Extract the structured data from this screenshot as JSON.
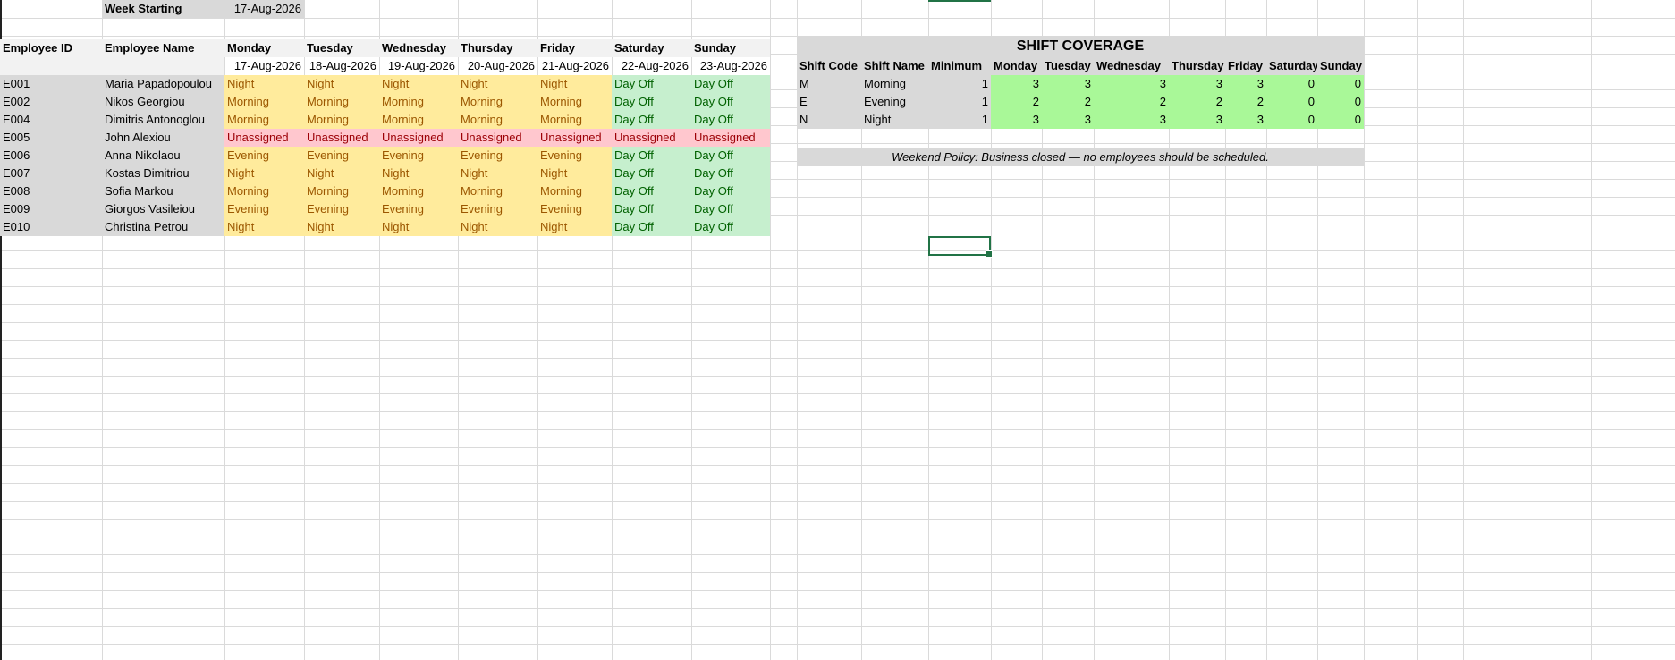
{
  "header": {
    "week_label": "Week Starting",
    "week_value": "17-Aug-2026"
  },
  "roster": {
    "columns": [
      "Employee ID",
      "Employee Name",
      "Monday",
      "Tuesday",
      "Wednesday",
      "Thursday",
      "Friday",
      "Saturday",
      "Sunday"
    ],
    "dates": [
      "17-Aug-2026",
      "18-Aug-2026",
      "19-Aug-2026",
      "20-Aug-2026",
      "21-Aug-2026",
      "22-Aug-2026",
      "23-Aug-2026"
    ],
    "rows": [
      {
        "id": "E001",
        "name": "Maria Papadopoulou",
        "days": [
          "Night",
          "Night",
          "Night",
          "Night",
          "Night",
          "Day Off",
          "Day Off"
        ]
      },
      {
        "id": "E002",
        "name": "Nikos Georgiou",
        "days": [
          "Morning",
          "Morning",
          "Morning",
          "Morning",
          "Morning",
          "Day Off",
          "Day Off"
        ]
      },
      {
        "id": "E004",
        "name": "Dimitris Antonoglou",
        "days": [
          "Morning",
          "Morning",
          "Morning",
          "Morning",
          "Morning",
          "Day Off",
          "Day Off"
        ]
      },
      {
        "id": "E005",
        "name": "John Alexiou",
        "days": [
          "Unassigned",
          "Unassigned",
          "Unassigned",
          "Unassigned",
          "Unassigned",
          "Unassigned",
          "Unassigned"
        ]
      },
      {
        "id": "E006",
        "name": "Anna Nikolaou",
        "days": [
          "Evening",
          "Evening",
          "Evening",
          "Evening",
          "Evening",
          "Day Off",
          "Day Off"
        ]
      },
      {
        "id": "E007",
        "name": "Kostas Dimitriou",
        "days": [
          "Night",
          "Night",
          "Night",
          "Night",
          "Night",
          "Day Off",
          "Day Off"
        ]
      },
      {
        "id": "E008",
        "name": "Sofia Markou",
        "days": [
          "Morning",
          "Morning",
          "Morning",
          "Morning",
          "Morning",
          "Day Off",
          "Day Off"
        ]
      },
      {
        "id": "E009",
        "name": "Giorgos Vasileiou",
        "days": [
          "Evening",
          "Evening",
          "Evening",
          "Evening",
          "Evening",
          "Day Off",
          "Day Off"
        ]
      },
      {
        "id": "E010",
        "name": "Christina Petrou",
        "days": [
          "Night",
          "Night",
          "Night",
          "Night",
          "Night",
          "Day Off",
          "Day Off"
        ]
      }
    ]
  },
  "coverage": {
    "title": "SHIFT COVERAGE",
    "columns": [
      "Shift Code",
      "Shift Name",
      "Minimum",
      "Monday",
      "Tuesday",
      "Wednesday",
      "Thursday",
      "Friday",
      "Saturday",
      "Sunday"
    ],
    "rows": [
      {
        "code": "M",
        "name": "Morning",
        "minimum": "1",
        "values": [
          "3",
          "3",
          "3",
          "3",
          "3",
          "0",
          "0"
        ]
      },
      {
        "code": "E",
        "name": "Evening",
        "minimum": "1",
        "values": [
          "2",
          "2",
          "2",
          "2",
          "2",
          "0",
          "0"
        ]
      },
      {
        "code": "N",
        "name": "Night",
        "minimum": "1",
        "values": [
          "3",
          "3",
          "3",
          "3",
          "3",
          "0",
          "0"
        ]
      }
    ],
    "policy": "Weekend Policy: Business closed — no employees should be scheduled."
  },
  "colors": {
    "header_gray": "#d9d9d9",
    "shift_yellow": "#ffeb9c",
    "dayoff_green": "#c6efce",
    "unassigned_red": "#ffc7ce",
    "coverage_green": "#a9f898",
    "selection": "#217346"
  }
}
